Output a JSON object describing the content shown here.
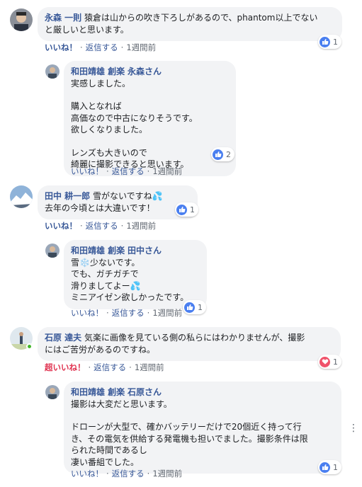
{
  "comments": [
    {
      "author": "永森 一則",
      "lines": [
        "猿倉は山からの吹き下ろしがあるので、phantom以上でない",
        "と厳しいと思います。"
      ],
      "reaction_count": "1",
      "like_label": "いいね！",
      "reply_label": "返信する",
      "time": "1週間前"
    },
    {
      "author": "和田靖雄 創楽",
      "mention": "永森さん",
      "lines": [
        "実感しました。",
        "",
        "購入となれば",
        "高価なので中古になりそうです。",
        "欲しくなりました。",
        "",
        "レンズも大きいので",
        "綺麗に撮影できると思います。"
      ],
      "reaction_count": "2",
      "like_label": "いいね！",
      "reply_label": "返信する",
      "time": "1週間前"
    },
    {
      "author": "田中 耕一郎",
      "first_text": "雪がないですね💦",
      "lines": [
        "去年の今頃とは大違いです！"
      ],
      "reaction_count": "1",
      "like_label": "いいね！",
      "reply_label": "返信する",
      "time": "1週間前"
    },
    {
      "author": "和田靖雄 創楽",
      "mention": "田中さん",
      "lines": [
        "雪❄️少ないです。",
        "でも、ガチガチで",
        "滑りましてよー💦",
        "ミニアイゼン欲しかったです。"
      ],
      "reaction_count": "1",
      "like_label": "いいね！",
      "reply_label": "返信する",
      "time": "1週間前"
    },
    {
      "author": "石原 達夫",
      "first_text": "気楽に画像を見ている側の私らにはわかりませんが、撮影",
      "lines": [
        "にはご苦労があるのですね。"
      ],
      "reaction_count": "1",
      "like_label": "超いいね！",
      "reply_label": "返信する",
      "time": "1週間前"
    },
    {
      "author": "和田靖雄 創楽",
      "mention": "石原さん",
      "lines": [
        "撮影は大変だと思います。",
        "",
        "ドローンが大型で、確かバッテリーだけで20個近く持って行",
        "き、その電気を供給する発電機も担いでました。撮影条件は限",
        "られた時間であるし",
        "凄い番組でした。"
      ],
      "reaction_count": "1",
      "like_label": "いいね！",
      "reply_label": "返信する",
      "time": "1週間前"
    }
  ],
  "icons": {
    "like": "thumbs-up-icon",
    "love": "heart-icon",
    "more": "more-options-icon"
  },
  "colors": {
    "author": "#385898",
    "bubble": "#f2f3f5",
    "like": "#4a7ff0",
    "love": "#f0536b",
    "online": "#42b72a"
  }
}
